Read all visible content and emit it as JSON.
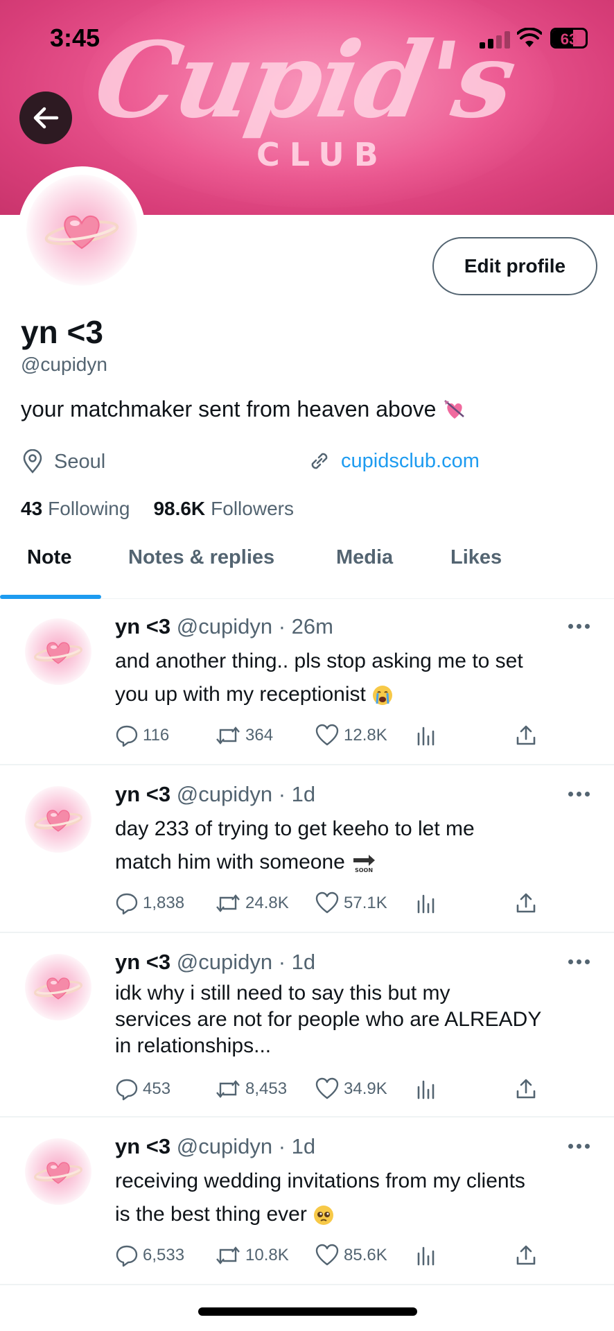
{
  "status_bar": {
    "time": "3:45",
    "battery": "63",
    "battery_level": 0.63
  },
  "banner": {
    "logo_text": "Cupid's",
    "logo_sub": "CLUB"
  },
  "profile": {
    "name": "yn <3",
    "handle": "@cupidyn",
    "bio": "your matchmaker sent from heaven above",
    "location": "Seoul",
    "website": "cupidsclub.com",
    "following_count": "43",
    "following_label": "Following",
    "followers_count": "98.6K",
    "followers_label": "Followers",
    "edit_button": "Edit profile"
  },
  "tabs": [
    {
      "label": "Note",
      "active": true
    },
    {
      "label": "Notes & replies",
      "active": false
    },
    {
      "label": "Media",
      "active": false
    },
    {
      "label": "Likes",
      "active": false
    }
  ],
  "posts": [
    {
      "name": "yn <3",
      "handle": "@cupidyn",
      "time": "26m",
      "lines": [
        "and another thing.. pls stop asking me to set",
        "you up with my receptionist"
      ],
      "emoji": "crying-face",
      "replies": "116",
      "reposts": "364",
      "likes": "12.8K"
    },
    {
      "name": "yn <3",
      "handle": "@cupidyn",
      "time": "1d",
      "lines": [
        "day 233 of trying to get keeho to let me",
        "match him with someone"
      ],
      "emoji": "soon-arrow",
      "replies": "1,838",
      "reposts": "24.8K",
      "likes": "57.1K"
    },
    {
      "name": "yn <3",
      "handle": "@cupidyn",
      "time": "1d",
      "lines": [
        "idk why i still need to say this but my",
        "services are not for people who are ALREADY",
        "in relationships..."
      ],
      "emoji": "",
      "replies": "453",
      "reposts": "8,453",
      "likes": "34.9K"
    },
    {
      "name": "yn <3",
      "handle": "@cupidyn",
      "time": "1d",
      "lines": [
        "receiving wedding invitations from my clients",
        "is the best thing ever"
      ],
      "emoji": "pleading-face",
      "replies": "6,533",
      "reposts": "10.8K",
      "likes": "85.6K"
    }
  ],
  "colors": {
    "accent": "#1d9bf0",
    "banner": "#e8548d",
    "secondary_text": "#536471"
  }
}
